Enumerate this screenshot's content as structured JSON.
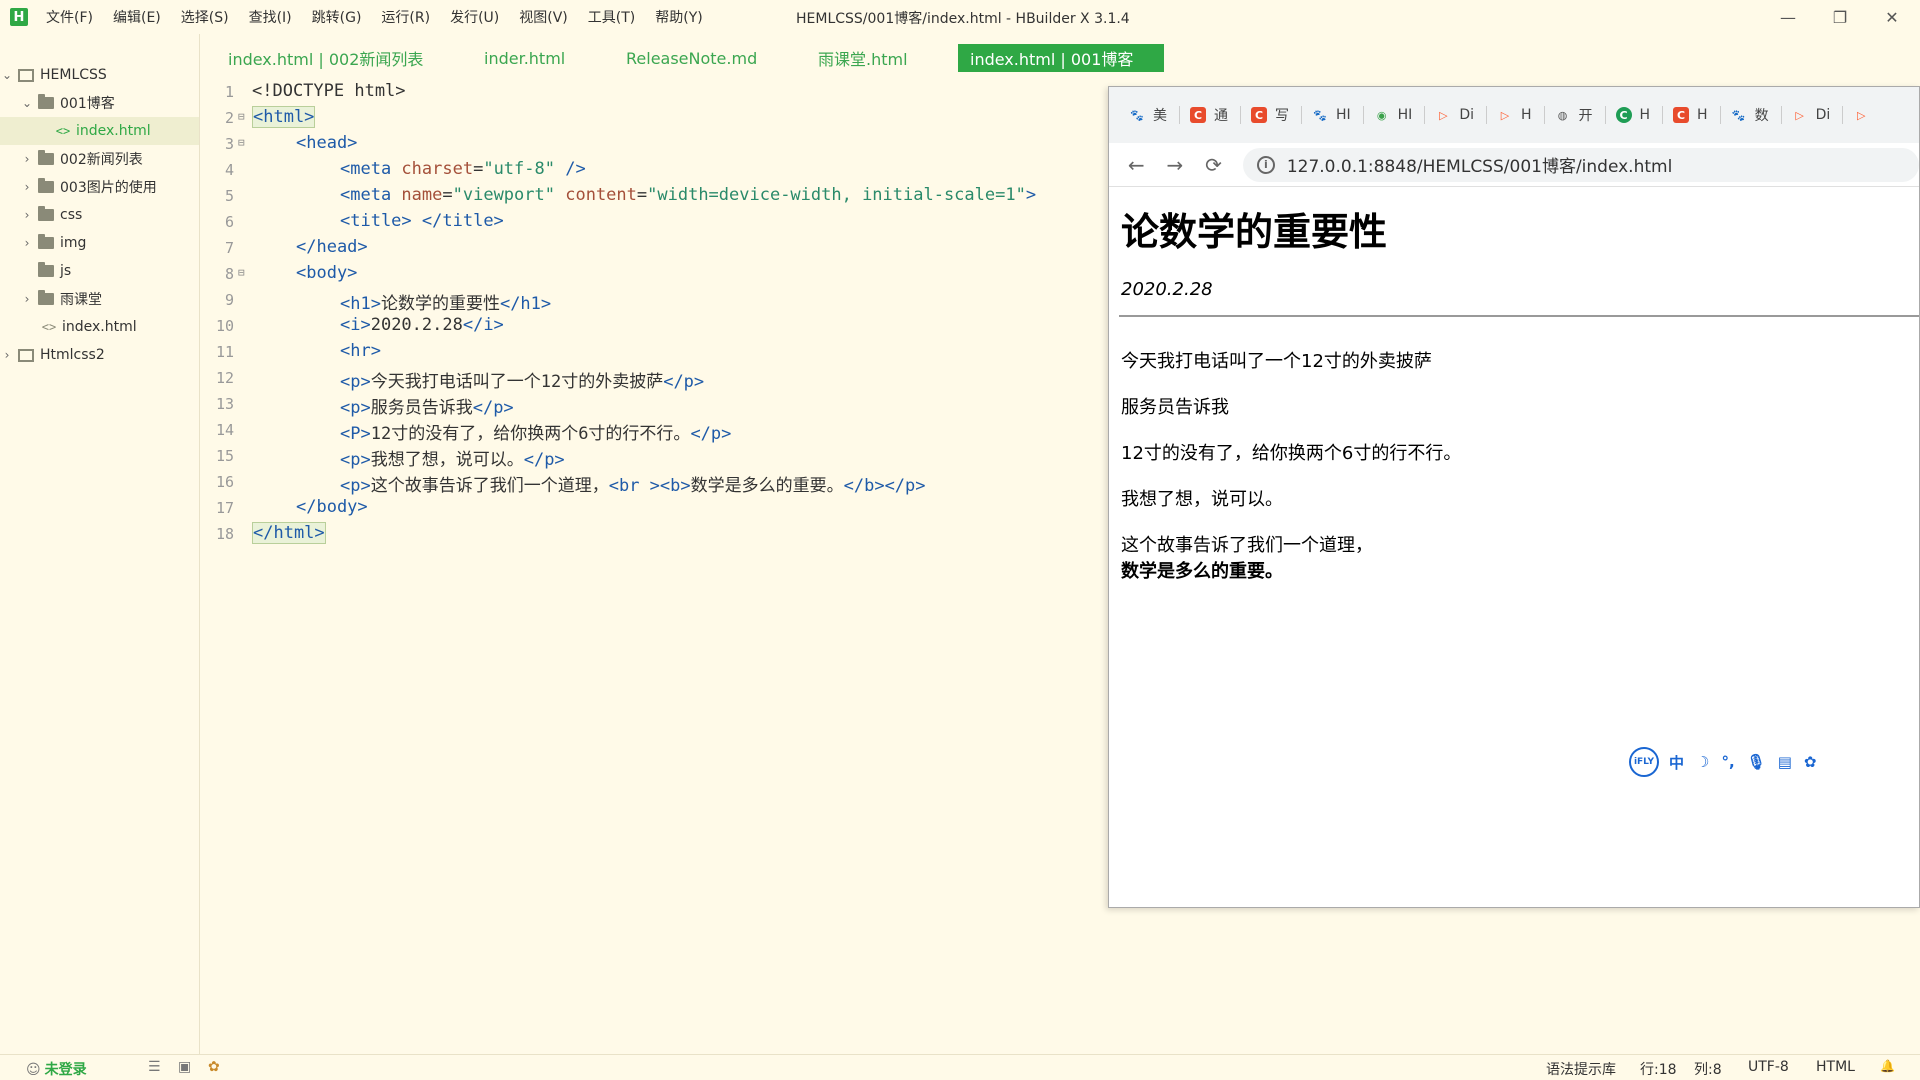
{
  "app": {
    "logo": "H",
    "window_title": "HEMLCSS/001博客/index.html - HBuilder X 3.1.4",
    "menu": [
      "文件(F)",
      "编辑(E)",
      "选择(S)",
      "查找(I)",
      "跳转(G)",
      "运行(R)",
      "发行(U)",
      "视图(V)",
      "工具(T)",
      "帮助(Y)"
    ],
    "window_controls": {
      "minimize": "—",
      "restore": "❐",
      "close": "✕"
    }
  },
  "sidebar": {
    "items": [
      {
        "label": "HEMLCSS",
        "type": "project",
        "expanded": true
      },
      {
        "label": "001博客",
        "type": "folder",
        "expanded": true
      },
      {
        "label": "index.html",
        "type": "file",
        "selected": true
      },
      {
        "label": "002新闻列表",
        "type": "folder",
        "expanded": false
      },
      {
        "label": "003图片的使用",
        "type": "folder",
        "expanded": false
      },
      {
        "label": "css",
        "type": "folder",
        "expanded": false
      },
      {
        "label": "img",
        "type": "folder",
        "expanded": false
      },
      {
        "label": "js",
        "type": "folder",
        "expanded": false
      },
      {
        "label": "雨课堂",
        "type": "folder",
        "expanded": false
      },
      {
        "label": "index.html",
        "type": "file"
      },
      {
        "label": "Htmlcss2",
        "type": "project",
        "expanded": false
      }
    ]
  },
  "tabs": [
    {
      "label": "index.html | 002新闻列表"
    },
    {
      "label": "inder.html"
    },
    {
      "label": "ReleaseNote.md"
    },
    {
      "label": "雨课堂.html"
    },
    {
      "label": "index.html | 001博客",
      "active": true
    }
  ],
  "editor": {
    "line_numbers": [
      "1",
      "2",
      "3",
      "4",
      "5",
      "6",
      "7",
      "8",
      "9",
      "10",
      "11",
      "12",
      "13",
      "14",
      "15",
      "16",
      "17",
      "18"
    ],
    "fold_marker": "⊟",
    "lines": [
      {
        "t1": "<!DOCTYPE html>"
      },
      {
        "t1": "<html>"
      },
      {
        "t1": "<head>"
      },
      {
        "t1": "<meta ",
        "a1": "charset",
        "t2": "=",
        "v1": "\"utf-8\"",
        "t3": " />"
      },
      {
        "t1": "<meta ",
        "a1": "name",
        "t2": "=",
        "v1": "\"viewport\"",
        "t3": " ",
        "a2": "content",
        "t4": "=",
        "v2": "\"width=device-width, initial-scale=1\"",
        "t5": ">"
      },
      {
        "t1": "<title>",
        "x1": " ",
        "t2": "</title>"
      },
      {
        "t1": "</head>"
      },
      {
        "t1": "<body>"
      },
      {
        "t1": "<h1>",
        "x1": "论数学的重要性",
        "t2": "</h1>"
      },
      {
        "t1": "<i>",
        "x1": "2020.2.28",
        "t2": "</i>"
      },
      {
        "t1": "<hr>"
      },
      {
        "t1": "<p>",
        "x1": "今天我打电话叫了一个12寸的外卖披萨",
        "t2": "</p>"
      },
      {
        "t1": "<p>",
        "x1": "服务员告诉我",
        "t2": "</p>"
      },
      {
        "t1": "<P>",
        "x1": "12寸的没有了，给你换两个6寸的行不行。",
        "t2": "</p>"
      },
      {
        "t1": "<p>",
        "x1": "我想了想，说可以。",
        "t2": "</p>"
      },
      {
        "t1": "<p>",
        "x1": "这个故事告诉了我们一个道理，",
        "t2": "<br >",
        "t3": "<b>",
        "x2": "数学是多么的重要。",
        "t4": "</b></p>"
      },
      {
        "t1": "</body>"
      },
      {
        "t1": "</html>"
      }
    ]
  },
  "browser": {
    "bookmarks": [
      {
        "icon": "baidu-paw-icon",
        "color": "#2a62d6",
        "glyph": "🐾",
        "label": "美"
      },
      {
        "icon": "csdn-icon",
        "color": "#e84b2c",
        "glyph": "C",
        "label": "通"
      },
      {
        "icon": "csdn-icon",
        "color": "#e84b2c",
        "glyph": "C",
        "label": "写"
      },
      {
        "icon": "baidu-paw-icon",
        "color": "#2a62d6",
        "glyph": "🐾",
        "label": "HI"
      },
      {
        "icon": "green-eye-icon",
        "color": "#3aa14a",
        "glyph": "◉",
        "label": "HI"
      },
      {
        "icon": "play-outline-icon",
        "color": "#ff5a2d",
        "glyph": "▷",
        "label": "Di"
      },
      {
        "icon": "play-outline-icon",
        "color": "#ff5a2d",
        "glyph": "▷",
        "label": "H"
      },
      {
        "icon": "globe-icon",
        "color": "#555555",
        "glyph": "◍",
        "label": "开"
      },
      {
        "icon": "green-c-icon",
        "color": "#1f9d55",
        "glyph": "C",
        "label": "H"
      },
      {
        "icon": "csdn-icon",
        "color": "#e84b2c",
        "glyph": "C",
        "label": "H"
      },
      {
        "icon": "baidu-paw-icon",
        "color": "#2a62d6",
        "glyph": "🐾",
        "label": "数"
      },
      {
        "icon": "play-outline-icon",
        "color": "#ff5a2d",
        "glyph": "▷",
        "label": "Di"
      },
      {
        "icon": "play-outline-icon",
        "color": "#ff5a2d",
        "glyph": "▷",
        "label": ""
      }
    ],
    "nav": {
      "back": "←",
      "forward": "→",
      "reload": "⟳",
      "info": "i"
    },
    "url": "127.0.0.1:8848/HEMLCSS/001博客/index.html",
    "page": {
      "h1": "论数学的重要性",
      "date": "2020.2.28",
      "paragraphs": [
        "今天我打电话叫了一个12寸的外卖披萨",
        "服务员告诉我",
        "12寸的没有了，给你换两个6寸的行不行。",
        "我想了想，说可以。",
        "这个故事告诉了我们一个道理，"
      ],
      "bold": "数学是多么的重要。"
    },
    "ime": {
      "logo": "iFLY",
      "items": [
        "中",
        "☽",
        "°,",
        "🎙",
        "▤",
        "✿"
      ]
    }
  },
  "statusbar": {
    "login": "未登录",
    "hint_lib": "语法提示库",
    "row": "行:18",
    "col": "列:8",
    "encoding": "UTF-8",
    "lang": "HTML",
    "bell": "🔔"
  },
  "colors": {
    "accent": "#2fa845",
    "tag": "#1e5aa8",
    "attr": "#a4503a",
    "value": "#2a8a6a",
    "background": "#fffae8"
  }
}
